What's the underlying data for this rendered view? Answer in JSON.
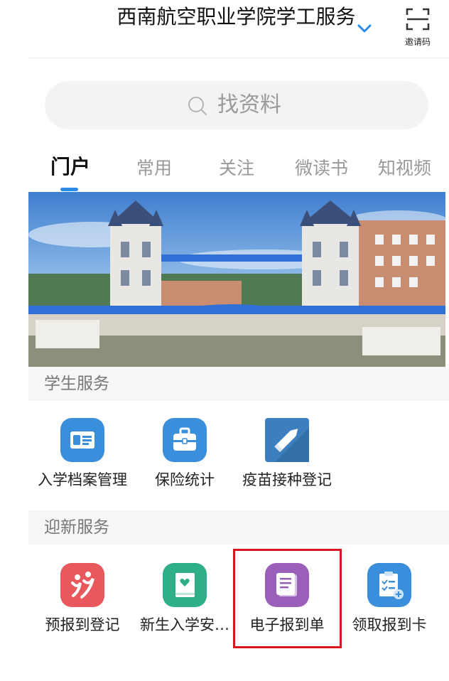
{
  "header": {
    "title": "西南航空职业学院学工服务",
    "invite_label": "邀请码"
  },
  "search": {
    "placeholder": "找资料"
  },
  "tabs": [
    {
      "label": "门户",
      "active": true
    },
    {
      "label": "常用",
      "active": false
    },
    {
      "label": "关注",
      "active": false
    },
    {
      "label": "微读书",
      "active": false
    },
    {
      "label": "知视频",
      "active": false
    }
  ],
  "sections": {
    "student": {
      "title": "学生服务",
      "apps": [
        {
          "label": "入学档案管理",
          "icon": "id-card-icon",
          "color": "#3a8fdc"
        },
        {
          "label": "保险统计",
          "icon": "briefcase-icon",
          "color": "#3a8fdc"
        },
        {
          "label": "疫苗接种登记",
          "icon": "pencil-icon",
          "color": "#3b7fbf"
        }
      ]
    },
    "welcome": {
      "title": "迎新服务",
      "apps": [
        {
          "label": "预报到登记",
          "icon": "people-icon",
          "color": "#e8585c"
        },
        {
          "label": "新生入学安…",
          "icon": "heart-book-icon",
          "color": "#2fae8a"
        },
        {
          "label": "电子报到单",
          "icon": "scroll-icon",
          "color": "#9a5fb8"
        },
        {
          "label": "领取报到卡",
          "icon": "clipboard-check-icon",
          "color": "#3a8fdc"
        }
      ]
    }
  },
  "colors": {
    "accent": "#2b8ae6",
    "highlight_border": "#d9171e"
  }
}
